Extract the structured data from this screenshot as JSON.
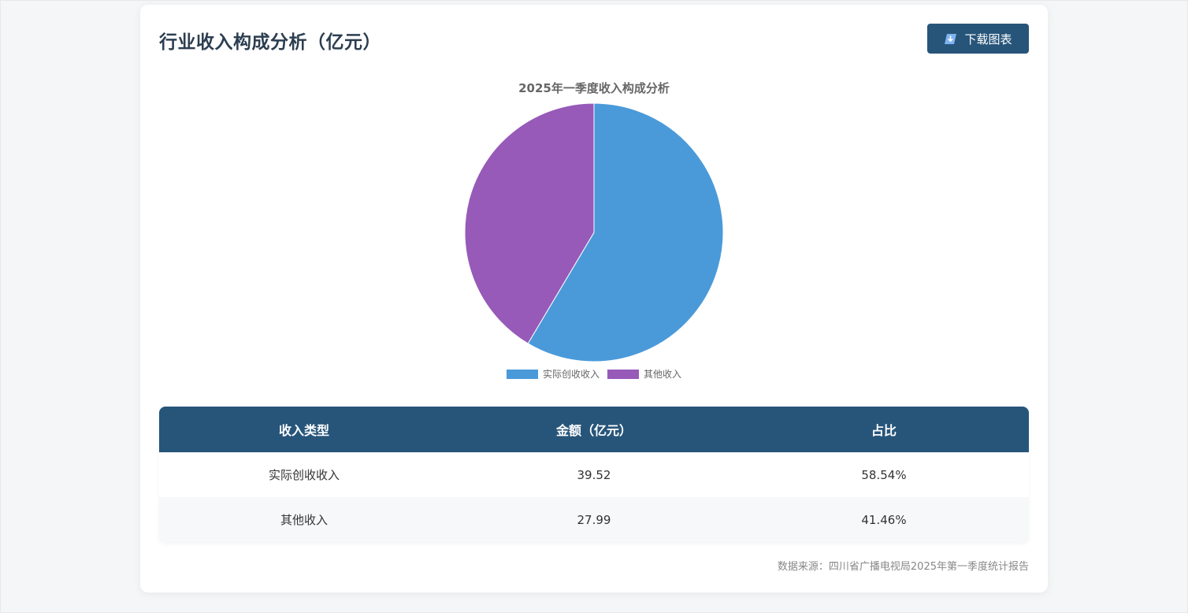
{
  "card": {
    "title": "行业收入构成分析（亿元）",
    "download_label": "下载图表",
    "download_icon": "download-icon"
  },
  "chart_data": {
    "type": "pie",
    "title": "2025年一季度收入构成分析",
    "categories": [
      "实际创收收入",
      "其他收入"
    ],
    "values": [
      39.52,
      27.99
    ],
    "colors": [
      "#4a9ada",
      "#975ab8"
    ],
    "legend_position": "bottom"
  },
  "table": {
    "headers": [
      "收入类型",
      "金额（亿元）",
      "占比"
    ],
    "rows": [
      [
        "实际创收收入",
        "39.52",
        "58.54%"
      ],
      [
        "其他收入",
        "27.99",
        "41.46%"
      ]
    ]
  },
  "source": "数据来源：四川省广播电视局2025年第一季度统计报告",
  "colors": {
    "accent": "#27557a",
    "title": "#2c3e50"
  }
}
